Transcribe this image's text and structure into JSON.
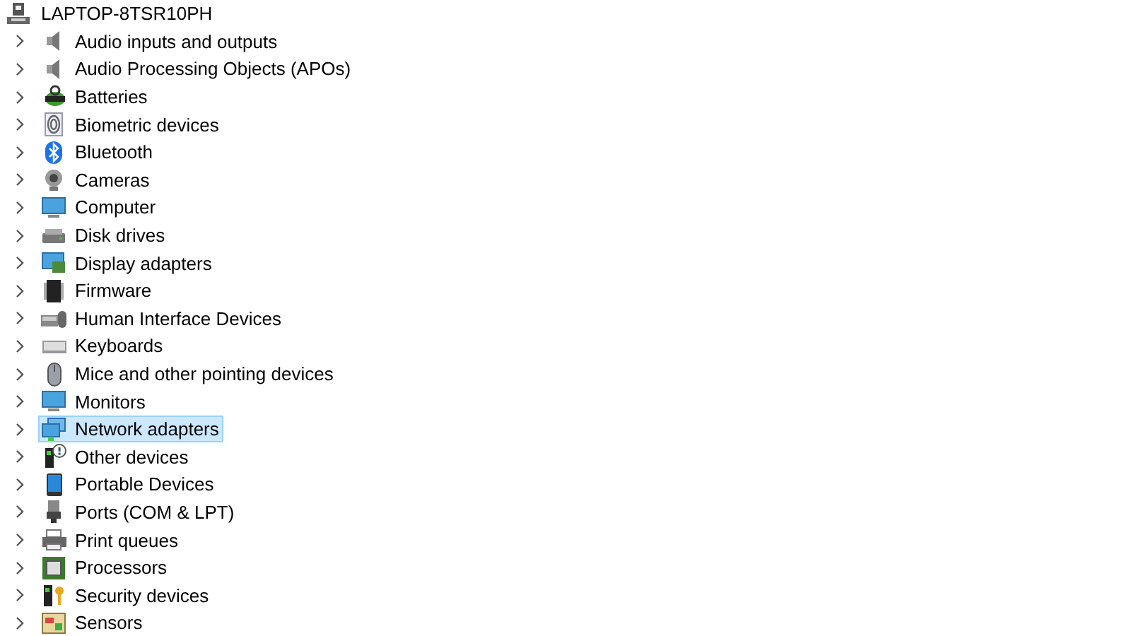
{
  "root": {
    "label": "LAPTOP-8TSR10PH",
    "kind": "computer"
  },
  "items": [
    {
      "label": "Audio inputs and outputs",
      "kind": "speaker",
      "expanded": false,
      "selected": false
    },
    {
      "label": "Audio Processing Objects (APOs)",
      "kind": "speaker",
      "expanded": false,
      "selected": false
    },
    {
      "label": "Batteries",
      "kind": "battery",
      "expanded": false,
      "selected": false
    },
    {
      "label": "Biometric devices",
      "kind": "fingerprint",
      "expanded": false,
      "selected": false
    },
    {
      "label": "Bluetooth",
      "kind": "bluetooth",
      "expanded": false,
      "selected": false
    },
    {
      "label": "Cameras",
      "kind": "camera",
      "expanded": false,
      "selected": false
    },
    {
      "label": "Computer",
      "kind": "monitor",
      "expanded": false,
      "selected": false
    },
    {
      "label": "Disk drives",
      "kind": "disk",
      "expanded": false,
      "selected": false
    },
    {
      "label": "Display adapters",
      "kind": "display",
      "expanded": false,
      "selected": false
    },
    {
      "label": "Firmware",
      "kind": "chip",
      "expanded": false,
      "selected": false
    },
    {
      "label": "Human Interface Devices",
      "kind": "hid",
      "expanded": false,
      "selected": false
    },
    {
      "label": "Keyboards",
      "kind": "keyboard",
      "expanded": false,
      "selected": false
    },
    {
      "label": "Mice and other pointing devices",
      "kind": "mouse",
      "expanded": false,
      "selected": false
    },
    {
      "label": "Monitors",
      "kind": "monitor",
      "expanded": false,
      "selected": false
    },
    {
      "label": "Network adapters",
      "kind": "network",
      "expanded": false,
      "selected": true
    },
    {
      "label": "Other devices",
      "kind": "other",
      "expanded": false,
      "selected": false
    },
    {
      "label": "Portable Devices",
      "kind": "portable",
      "expanded": false,
      "selected": false
    },
    {
      "label": "Ports (COM & LPT)",
      "kind": "port",
      "expanded": false,
      "selected": false
    },
    {
      "label": "Print queues",
      "kind": "printer",
      "expanded": false,
      "selected": false
    },
    {
      "label": "Processors",
      "kind": "processor",
      "expanded": false,
      "selected": false
    },
    {
      "label": "Security devices",
      "kind": "security",
      "expanded": false,
      "selected": false
    },
    {
      "label": "Sensors",
      "kind": "sensor",
      "expanded": false,
      "selected": false
    }
  ]
}
